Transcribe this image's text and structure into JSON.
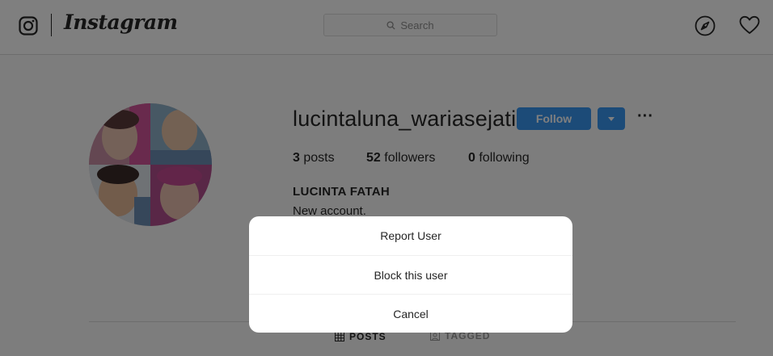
{
  "header": {
    "brand": "Instagram",
    "search_placeholder": "Search",
    "icons": [
      "instagram-glyph-icon",
      "search-icon",
      "compass-icon",
      "heart-icon"
    ]
  },
  "profile": {
    "username": "lucintaluna_wariasejati",
    "follow_label": "Follow",
    "stats": {
      "posts_count": "3",
      "posts_label": "posts",
      "followers_count": "52",
      "followers_label": "followers",
      "following_count": "0",
      "following_label": "following"
    },
    "full_name": "LUCINTA FATAH",
    "bio": "New account."
  },
  "tabs": {
    "posts": "POSTS",
    "tagged": "TAGGED"
  },
  "modal": {
    "report": "Report User",
    "block": "Block this user",
    "cancel": "Cancel"
  },
  "colors": {
    "accent": "#3897f0",
    "text": "#262626",
    "overlay": "rgba(0,0,0,0.5)"
  }
}
